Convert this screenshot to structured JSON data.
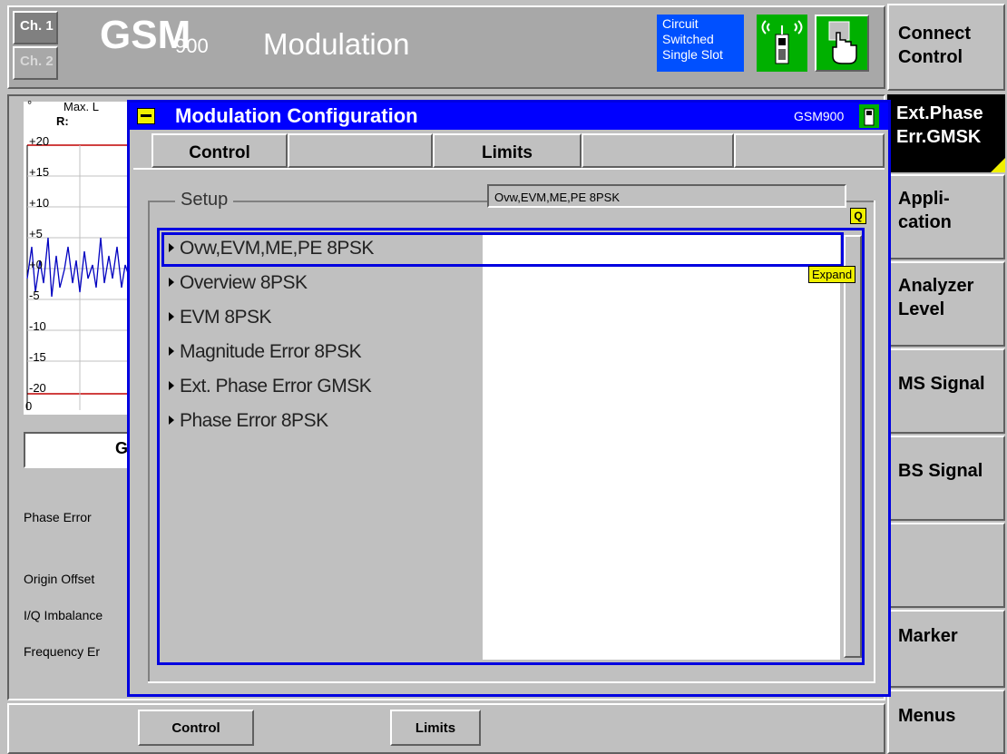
{
  "header": {
    "channel_1": "Ch. 1",
    "channel_2": "Ch. 2",
    "standard": "GSM",
    "band": "900",
    "mode": "Modulation",
    "connection_status": [
      "Circuit",
      "Switched",
      "Single Slot"
    ],
    "ms_icon": "mobile-phone-icon",
    "hand_icon": "hand-pointer-icon"
  },
  "softkeys": [
    {
      "label": "Connect Control"
    },
    {
      "label": "Ext.Phase Err.GMSK"
    },
    {
      "label": "Appli- cation"
    },
    {
      "label": "Analyzer Level"
    },
    {
      "label": "MS Signal"
    },
    {
      "label": "BS Signal"
    },
    {
      "label": ""
    },
    {
      "label": "Marker"
    },
    {
      "label": "Menus"
    }
  ],
  "graph": {
    "degree_label": "°",
    "max_label": "Max. L",
    "yticks": [
      "+20",
      "+15",
      "+10",
      "+5",
      "+0",
      "-5",
      "-10",
      "-15",
      "-20",
      "0"
    ],
    "result_title_partial": "G",
    "result_labels": [
      "Phase Error",
      "Origin Offset",
      "I/Q Imbalance",
      "Frequency Er"
    ]
  },
  "dialog": {
    "title": "Modulation Configuration",
    "band": "GSM900",
    "tabs": [
      "Control",
      "",
      "Limits",
      "",
      ""
    ],
    "setup_label": "Setup",
    "setup_value": "Ovw,EVM,ME,PE 8PSK",
    "expand_label": "Expand",
    "refresh_icon_text": "Q",
    "items": [
      "Ovw,EVM,ME,PE 8PSK",
      "Overview 8PSK",
      "EVM 8PSK",
      "Magnitude Error 8PSK",
      "Ext. Phase Error GMSK",
      "Phase Error 8PSK"
    ]
  },
  "bottom_buttons": [
    "Control",
    "Limits"
  ]
}
